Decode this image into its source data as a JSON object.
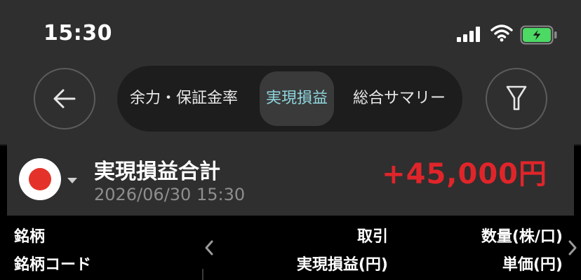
{
  "status_bar": {
    "time": "15:30"
  },
  "nav": {
    "back_icon": "arrow-left-icon",
    "filter_icon": "filter-icon",
    "tabs": [
      {
        "label": "余力・保証金率",
        "active": false
      },
      {
        "label": "実現損益",
        "active": true
      },
      {
        "label": "総合サマリー",
        "active": false
      }
    ]
  },
  "summary": {
    "flag_icon": "japan-flag-icon",
    "title": "実現損益合計",
    "datetime": "2026/06/30 15:30",
    "value": "+45,000円",
    "value_color": "#e0252a"
  },
  "table_header": {
    "col1_line1": "銘柄",
    "col1_line2": "銘柄コード",
    "col2_line1": "取引",
    "col2_line2": "実現損益(円)",
    "col3_line1": "数量(株/口)",
    "col3_line2": "単価(円)"
  },
  "colors": {
    "accent_tab": "#8fd6de",
    "profit": "#e0252a",
    "battery": "#4cd964"
  }
}
